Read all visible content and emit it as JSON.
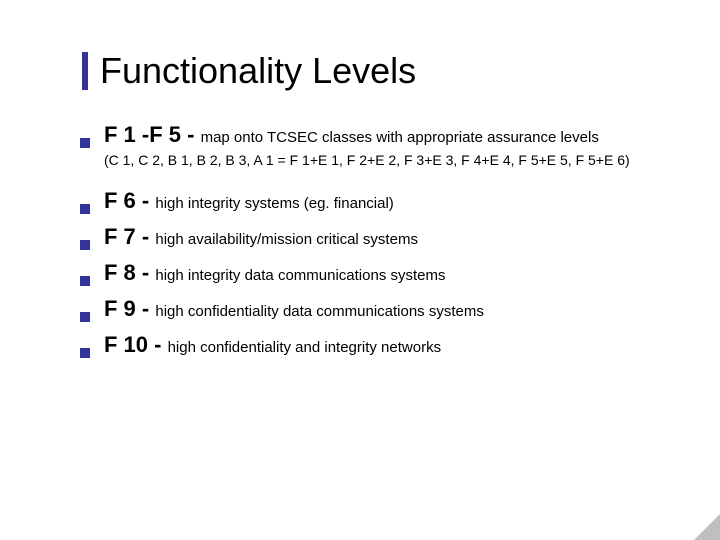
{
  "title": "Functionality Levels",
  "items": [
    {
      "label": "F 1 -F 5",
      "desc": "map onto TCSEC classes with appropriate assurance levels",
      "sub": "(C 1, C 2, B 1, B 2, B 3, A 1 = F 1+E 1, F 2+E 2, F 3+E 3, F 4+E 4, F 5+E 5, F 5+E 6)"
    },
    {
      "label": "F 6",
      "desc": "high integrity systems (eg. financial)"
    },
    {
      "label": "F 7",
      "desc": "high availability/mission critical systems"
    },
    {
      "label": "F 8",
      "desc": "high integrity data communications systems"
    },
    {
      "label": "F 9",
      "desc": "high confidentiality data communications systems"
    },
    {
      "label": "F 10",
      "desc": "high confidentiality and integrity networks"
    }
  ],
  "dash": " - "
}
